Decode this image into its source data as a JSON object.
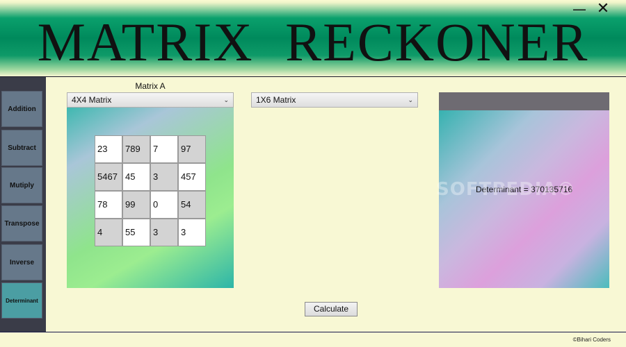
{
  "app": {
    "title": "MATRIX  RECKONER",
    "window_controls": {
      "minimize": "—",
      "close": "✕"
    }
  },
  "sidebar": {
    "items": [
      {
        "label": "Addition"
      },
      {
        "label": "Subtract"
      },
      {
        "label": "Mutiply"
      },
      {
        "label": "Transpose"
      },
      {
        "label": "Inverse"
      },
      {
        "label": "Determinant",
        "active": true
      }
    ]
  },
  "matrix_a": {
    "label": "Matrix A",
    "size_select": "4X4  Matrix",
    "cells": [
      [
        "23",
        "789",
        "7",
        "97"
      ],
      [
        "5467",
        "45",
        "3",
        "457"
      ],
      [
        "78",
        "99",
        "0",
        "54"
      ],
      [
        "4",
        "55",
        "3",
        "3"
      ]
    ]
  },
  "matrix_b": {
    "size_select": "1X6  Matrix"
  },
  "result": {
    "text": "Determinant = 370135716"
  },
  "watermark": "SOFTPEDIA®",
  "actions": {
    "calculate": "Calculate"
  },
  "footer": {
    "credit": "©Bihari Coders"
  },
  "colors": {
    "banner": "#008a5c",
    "sidebar": "#3a3c48",
    "sidebar_button": "#66788a",
    "sidebar_button_active": "#4b9ea3",
    "background": "#f8f8d4",
    "result_header": "#6e6b72"
  },
  "icons": {
    "dropdown": "chevron-down-icon"
  }
}
